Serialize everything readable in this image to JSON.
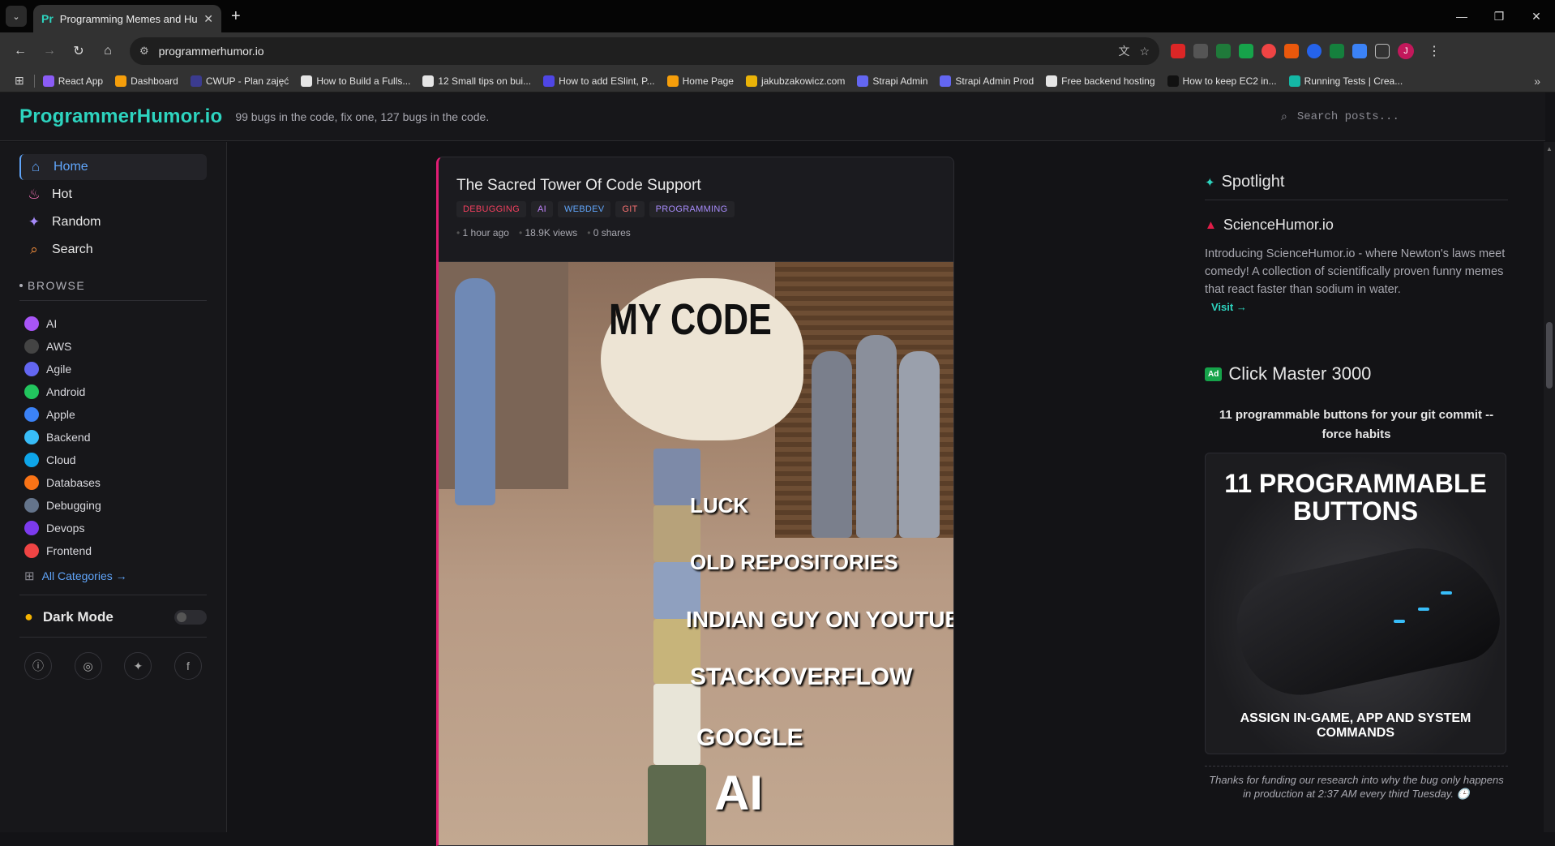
{
  "browser": {
    "tab_title": "Programming Memes and Hum",
    "tab_favicon": "Pr",
    "url": "programmerhumor.io",
    "bookmarks": [
      {
        "label": "React App",
        "color": "#8b5cf6"
      },
      {
        "label": "Dashboard",
        "color": "#f59e0b"
      },
      {
        "label": "CWUP - Plan zajęć",
        "color": "#3b3b8f"
      },
      {
        "label": "How to Build a Fulls...",
        "color": "#e5e5e5"
      },
      {
        "label": "12 Small tips on bui...",
        "color": "#e5e5e5"
      },
      {
        "label": "How to add ESlint, P...",
        "color": "#4f46e5"
      },
      {
        "label": "Home Page",
        "color": "#f59e0b"
      },
      {
        "label": "jakubzakowicz.com",
        "color": "#eab308"
      },
      {
        "label": "Strapi Admin",
        "color": "#6366f1"
      },
      {
        "label": "Strapi Admin Prod",
        "color": "#6366f1"
      },
      {
        "label": "Free backend hosting",
        "color": "#e5e5e5"
      },
      {
        "label": "How to keep EC2 in...",
        "color": "#111111"
      },
      {
        "label": "Running Tests | Crea...",
        "color": "#14b8a6"
      }
    ]
  },
  "header": {
    "logo": "ProgrammerHumor.io",
    "tagline": "99 bugs in the code, fix one, 127 bugs in the code.",
    "search_placeholder": "Search posts..."
  },
  "sidebar": {
    "nav": [
      {
        "label": "Home",
        "icon": "home-icon",
        "glyph": "⌂",
        "color": "#60a5fa",
        "active": true
      },
      {
        "label": "Hot",
        "icon": "flame-icon",
        "glyph": "♨",
        "color": "#f472b6",
        "active": false
      },
      {
        "label": "Random",
        "icon": "sparkles-icon",
        "glyph": "✦",
        "color": "#a78bfa",
        "active": false
      },
      {
        "label": "Search",
        "icon": "search-icon",
        "glyph": "⌕",
        "color": "#fb923c",
        "active": false
      }
    ],
    "browse_title": "BROWSE",
    "categories": [
      {
        "label": "AI",
        "color": "#a855f7"
      },
      {
        "label": "AWS",
        "color": "#444444"
      },
      {
        "label": "Agile",
        "color": "#6366f1"
      },
      {
        "label": "Android",
        "color": "#22c55e"
      },
      {
        "label": "Apple",
        "color": "#3b82f6"
      },
      {
        "label": "Backend",
        "color": "#38bdf8"
      },
      {
        "label": "Cloud",
        "color": "#0ea5e9"
      },
      {
        "label": "Databases",
        "color": "#f97316"
      },
      {
        "label": "Debugging",
        "color": "#64748b"
      },
      {
        "label": "Devops",
        "color": "#7c3aed"
      },
      {
        "label": "Frontend",
        "color": "#ef4444"
      }
    ],
    "all_categories": "All Categories →",
    "dark_mode": "Dark Mode"
  },
  "post": {
    "title": "The Sacred Tower Of Code Support",
    "tags": [
      {
        "label": "DEBUGGING",
        "color": "#f43f5e"
      },
      {
        "label": "AI",
        "color": "#c084fc"
      },
      {
        "label": "WEBDEV",
        "color": "#60a5fa"
      },
      {
        "label": "GIT",
        "color": "#f87171"
      },
      {
        "label": "PROGRAMMING",
        "color": "#a78bfa"
      }
    ],
    "meta": [
      "1 hour ago",
      "18.9K views",
      "0 shares"
    ],
    "meme_captions": {
      "top": "MY CODE",
      "stack": [
        "LUCK",
        "OLD REPOSITORIES",
        "INDIAN GUY ON YOUTUBE",
        "STACKOVERFLOW",
        "GOOGLE"
      ],
      "bottom": "AI"
    }
  },
  "right": {
    "spotlight_title": "Spotlight",
    "spotlight_site": "ScienceHumor.io",
    "spotlight_desc": "Introducing ScienceHumor.io - where Newton's laws meet comedy! A collection of scientifically proven funny memes that react faster than sodium in water.",
    "visit": "Visit →",
    "ad_badge": "Ad",
    "ad_title": "Click Master 3000",
    "ad_subtitle": "11 programmable buttons for your git commit -- force habits",
    "ad_image_heading": "11 PROGRAMMABLE BUTTONS",
    "ad_image_footer": "ASSIGN IN-GAME, APP AND SYSTEM COMMANDS",
    "ad_footer": "Thanks for funding our research into why the bug only happens in production at 2:37 AM every third Tuesday. 🕒"
  }
}
